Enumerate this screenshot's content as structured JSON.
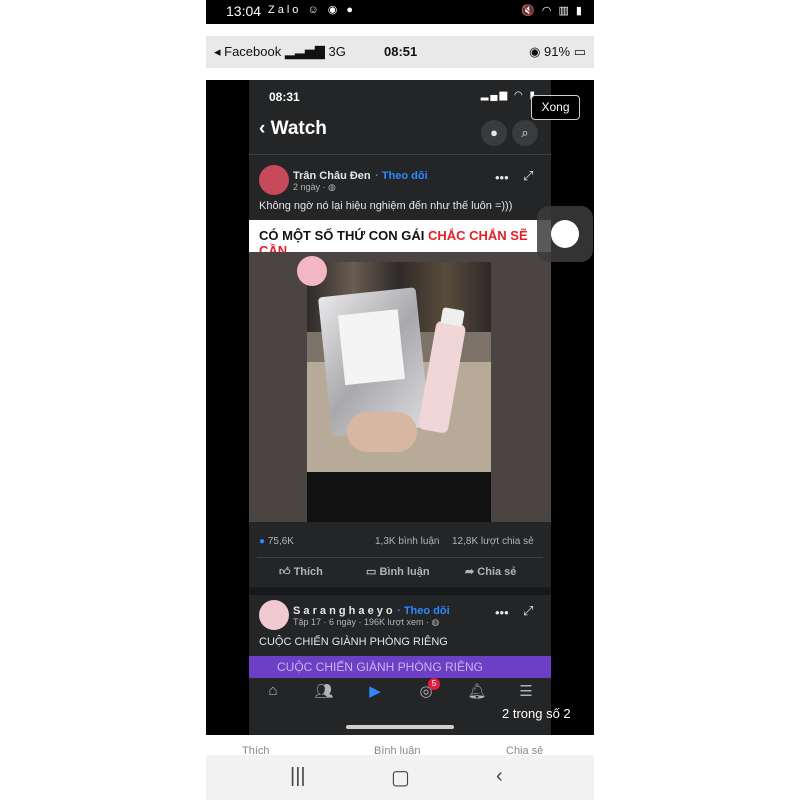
{
  "android_status": {
    "time": "13:04",
    "left_icons": "Zalo ☺ ◉ ●",
    "right_icons": "🔇 ◠ ▥ ▮"
  },
  "ios_status": {
    "back_label": "◂ Facebook",
    "signal": "3G",
    "time": "08:51",
    "battery": "91%"
  },
  "fb_status": {
    "time": "08:31"
  },
  "watch_header": {
    "title": "Watch"
  },
  "viewer": {
    "done_label": "Xong",
    "counter": "2 trong số 2"
  },
  "post1": {
    "author": "Trân Châu Đen",
    "follow": "· Theo dõi",
    "meta": "2 ngày · ◍",
    "text": "Không ngờ nó lại hiệu nghiệm đến như thế luôn =)))",
    "banner_black": "CÓ MỘT SỐ THỨ CON GÁI ",
    "banner_red": "CHẮC CHẮN SẼ CẦN",
    "reactions": "75,6K",
    "comments": "1,3K bình luận",
    "shares": "12,8K lượt chia sẻ",
    "like_label": "Thích",
    "comment_label": "Bình luận",
    "share_label": "Chia sẻ"
  },
  "post2": {
    "author": "S a r a n g h a e y o",
    "follow": "· Theo dõi",
    "meta": "Tập 17 · 6 ngày · 196K lượt xem · ◍",
    "text": "CUỘC CHIẾN GIÀNH PHÒNG RIÊNG",
    "banner": "CUỘC CHIẾN GIÀNH PHÒNG RIÊNG"
  },
  "tabbar": {
    "badge": "5"
  },
  "fb_bottom": {
    "like": "Thích",
    "comment": "Bình luận",
    "share": "Chia sẻ"
  },
  "colors": {
    "accent": "#2d88ff",
    "dark_bg": "#242526",
    "banner_red": "#e4202b"
  }
}
